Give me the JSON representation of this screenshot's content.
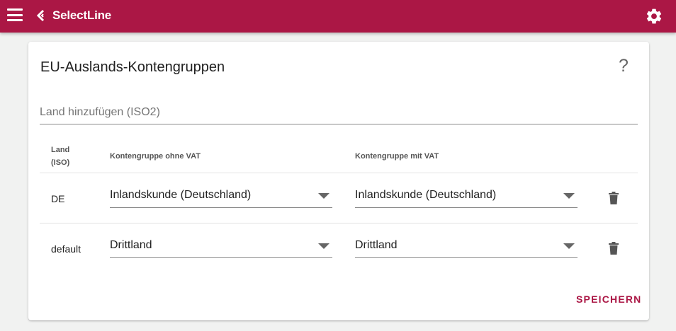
{
  "header": {
    "brand": "SelectLine",
    "menu_icon": "hamburger-menu-icon",
    "brand_icon": "selectline-logo-icon",
    "settings_icon": "gear-icon",
    "bar_color": "#ab1745"
  },
  "card": {
    "title": "EU-Auslands-Kontengruppen",
    "help_label": "?",
    "add_field": {
      "value": "",
      "placeholder": "Land hinzufügen (ISO2)"
    },
    "table": {
      "headers": {
        "land_line1": "Land",
        "land_line2": "(ISO)",
        "ohne_vat": "Kontengruppe ohne VAT",
        "mit_vat": "Kontengruppe mit VAT"
      },
      "rows": [
        {
          "land": "DE",
          "ohne_vat": "Inlandskunde (Deutschland)",
          "mit_vat": "Inlandskunde (Deutschland)"
        },
        {
          "land": "default",
          "ohne_vat": "Drittland",
          "mit_vat": "Drittland"
        }
      ]
    },
    "save_label": "SPEICHERN"
  }
}
